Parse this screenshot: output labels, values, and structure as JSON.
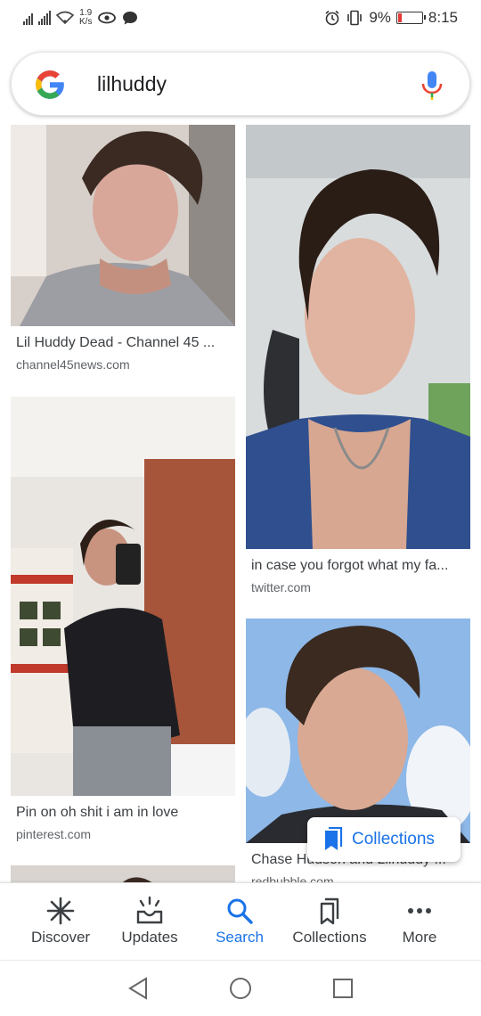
{
  "status_bar": {
    "speed_value": "1.9",
    "speed_unit": "K/s",
    "battery_percent": "9%",
    "time": "8:15",
    "icons": [
      "sim-signal-icon",
      "signal-icon",
      "wifi-icon",
      "eye-icon",
      "chat-bubble-icon",
      "alarm-icon",
      "vibrate-icon",
      "battery-icon"
    ]
  },
  "search": {
    "query": "lilhuddy",
    "logo": "google-g-logo",
    "mic_icon": "mic-icon"
  },
  "results": [
    {
      "title": "Lil Huddy Dead - Channel 45 ...",
      "source": "channel45news.com"
    },
    {
      "title": "in case you forgot what my fa...",
      "source": "twitter.com"
    },
    {
      "title": "Pin on oh shit i am in love",
      "source": "pinterest.com"
    },
    {
      "title": "Chase Hudson and Lilhuddy ...",
      "source": "redbubble.com"
    }
  ],
  "collections_chip": {
    "label": "Collections",
    "icon": "bookmark-icon"
  },
  "bottom_nav": [
    {
      "label": "Discover",
      "icon": "asterisk-icon",
      "active": false
    },
    {
      "label": "Updates",
      "icon": "inbox-updates-icon",
      "active": false
    },
    {
      "label": "Search",
      "icon": "search-icon",
      "active": true
    },
    {
      "label": "Collections",
      "icon": "collections-icon",
      "active": false
    },
    {
      "label": "More",
      "icon": "more-dots-icon",
      "active": false
    }
  ],
  "system_nav": [
    "back-icon",
    "home-icon",
    "recents-icon"
  ],
  "colors": {
    "accent": "#1a73e8",
    "battery_low": "#e53935"
  }
}
